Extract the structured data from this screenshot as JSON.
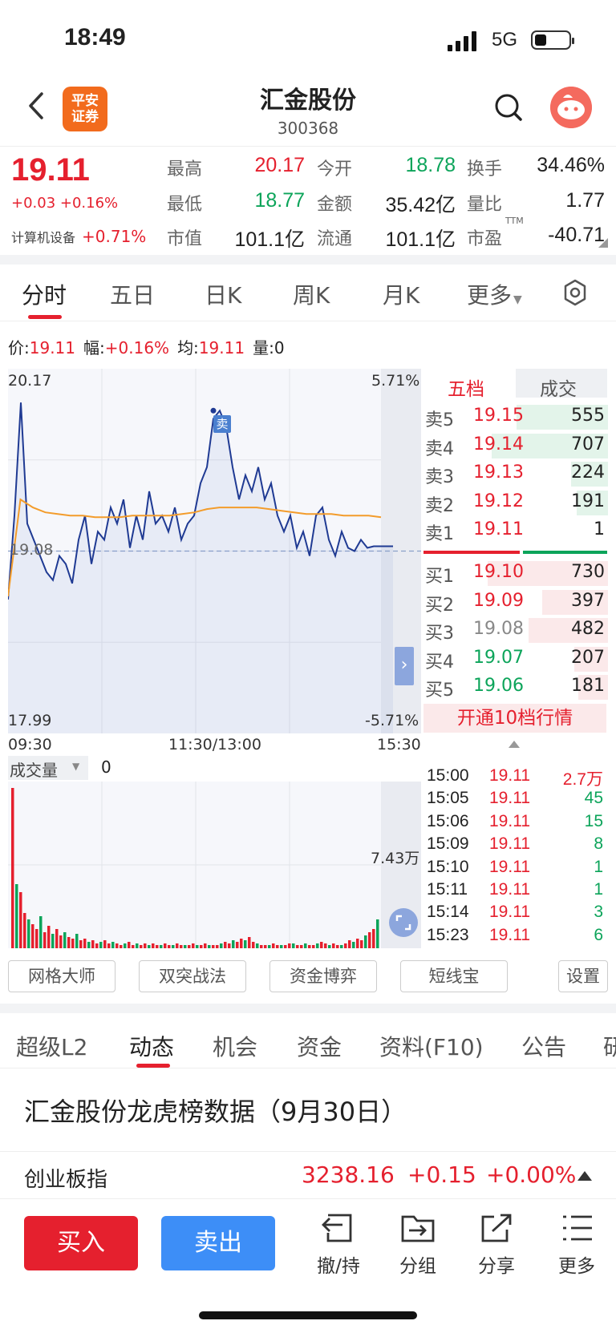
{
  "status_bar": {
    "time": "18:49",
    "network": "5G"
  },
  "header": {
    "back_icon": "chevron-left-icon",
    "logo_line1": "平安",
    "logo_line2": "证券",
    "title": "汇金股份",
    "code": "300368"
  },
  "quote": {
    "price": "19.11",
    "change": "+0.03 +0.16%",
    "sector_name": "计算机设备",
    "sector_change": "+0.71%",
    "fields": [
      {
        "label": "最高",
        "value": "20.17"
      },
      {
        "label": "今开",
        "value": "18.78"
      },
      {
        "label": "换手",
        "value": "34.46%"
      },
      {
        "label": "最低",
        "value": "18.77"
      },
      {
        "label": "金额",
        "value": "35.42亿"
      },
      {
        "label": "量比",
        "value": "1.77"
      },
      {
        "label": "市值",
        "value": "101.1亿"
      },
      {
        "label": "流通",
        "value": "101.1亿"
      },
      {
        "label": "市盈",
        "value": "-40.71"
      }
    ],
    "ttm": "TTM"
  },
  "chart_tabs": [
    "分时",
    "五日",
    "日K",
    "周K",
    "月K",
    "更多"
  ],
  "info_line": {
    "price_label": "价:",
    "price": "19.11",
    "amp_label": "幅:",
    "amp": "+0.16%",
    "avg_label": "均:",
    "avg": "19.11",
    "vol_label": "量:",
    "vol": "0"
  },
  "chart_labels": {
    "high": "20.17",
    "low": "17.99",
    "base": "19.08",
    "pct_high": "5.71%",
    "pct_low": "-5.71%",
    "t_start": "09:30",
    "t_mid": "11:30/13:00",
    "t_end": "15:30",
    "sell_marker": "卖",
    "volume_label": "成交量",
    "volume_value": "0",
    "volume_max": "7.43万"
  },
  "chart_data": {
    "type": "line",
    "x_range": [
      "09:30",
      "15:00"
    ],
    "ylim": [
      17.99,
      20.17
    ],
    "series": [
      {
        "values": [
          18.78,
          19.3,
          20.0,
          19.25,
          19.15,
          19.05,
          18.95,
          18.9,
          19.05,
          19.0,
          18.88,
          19.15,
          19.3,
          19.0,
          19.2,
          19.15,
          19.35,
          19.25,
          19.4,
          19.1,
          19.3,
          19.15,
          19.45,
          19.25,
          19.3,
          19.2,
          19.35,
          19.15,
          19.25,
          19.3,
          19.5,
          19.6,
          19.9,
          19.95,
          19.85,
          19.6,
          19.4,
          19.55,
          19.45,
          19.6,
          19.4,
          19.5,
          19.3,
          19.2,
          19.3,
          19.1,
          19.2,
          19.05,
          19.3,
          19.35,
          19.15,
          19.05,
          19.2,
          19.1,
          19.08,
          19.15,
          19.1,
          19.11,
          19.11,
          19.11,
          19.11
        ]
      },
      {
        "values": [
          18.8,
          19.4,
          19.35,
          19.32,
          19.31,
          19.3,
          19.3,
          19.29,
          19.29,
          19.29,
          19.3,
          19.3,
          19.3,
          19.3,
          19.31,
          19.32,
          19.34,
          19.35,
          19.35,
          19.35,
          19.35,
          19.34,
          19.33,
          19.32,
          19.31,
          19.31,
          19.31,
          19.3,
          19.3,
          19.3,
          19.29
        ]
      }
    ]
  },
  "order_book": {
    "tab_five": "五档",
    "tab_trades": "成交",
    "asks": [
      {
        "label": "卖5",
        "price": "19.15",
        "volume": "555",
        "ratio": 0.76
      },
      {
        "label": "卖4",
        "price": "19.14",
        "volume": "707",
        "ratio": 0.97
      },
      {
        "label": "卖3",
        "price": "19.13",
        "volume": "224",
        "ratio": 0.31
      },
      {
        "label": "卖2",
        "price": "19.12",
        "volume": "191",
        "ratio": 0.26
      },
      {
        "label": "卖1",
        "price": "19.11",
        "volume": "1",
        "ratio": 0
      }
    ],
    "bids": [
      {
        "label": "买1",
        "price": "19.10",
        "volume": "730",
        "ratio": 1.0
      },
      {
        "label": "买2",
        "price": "19.09",
        "volume": "397",
        "ratio": 0.55
      },
      {
        "label": "买3",
        "price": "19.08",
        "volume": "482",
        "ratio": 0.66
      },
      {
        "label": "买4",
        "price": "19.07",
        "volume": "207",
        "ratio": 0.28
      },
      {
        "label": "买5",
        "price": "19.06",
        "volume": "181",
        "ratio": 0.25
      }
    ],
    "upgrade": "开通10档行情"
  },
  "trades": [
    {
      "time": "15:00",
      "price": "19.11",
      "volume": "2.7万"
    },
    {
      "time": "15:05",
      "price": "19.11",
      "volume": "45"
    },
    {
      "time": "15:06",
      "price": "19.11",
      "volume": "15"
    },
    {
      "time": "15:09",
      "price": "19.11",
      "volume": "8"
    },
    {
      "time": "15:10",
      "price": "19.11",
      "volume": "1"
    },
    {
      "time": "15:11",
      "price": "19.11",
      "volume": "1"
    },
    {
      "time": "15:14",
      "price": "19.11",
      "volume": "3"
    },
    {
      "time": "15:23",
      "price": "19.11",
      "volume": "6"
    }
  ],
  "tools": [
    "网格大师",
    "双突战法",
    "资金博弈",
    "短线宝",
    "设置"
  ],
  "info_tabs": [
    "超级L2",
    "动态",
    "机会",
    "资金",
    "资料(F10)",
    "公告",
    "研"
  ],
  "news_title": "汇金股份龙虎榜数据（9月30日）",
  "index": {
    "name": "创业板指",
    "value": "3238.16",
    "change": "+0.15",
    "pct": "+0.00%"
  },
  "bottom_bar": {
    "buy": "买入",
    "sell": "卖出",
    "actions": [
      {
        "label": "撤/持",
        "icon": "withdraw-icon"
      },
      {
        "label": "分组",
        "icon": "folder-icon"
      },
      {
        "label": "分享",
        "icon": "share-icon"
      },
      {
        "label": "更多",
        "icon": "menu-icon"
      }
    ]
  },
  "colors": {
    "up": "#e5202e",
    "down": "#0ca45a",
    "price_line": "#1f3a93",
    "avg_line": "#f39c2b",
    "buy_button": "#e5202e",
    "sell_button": "#3d8ef7"
  }
}
